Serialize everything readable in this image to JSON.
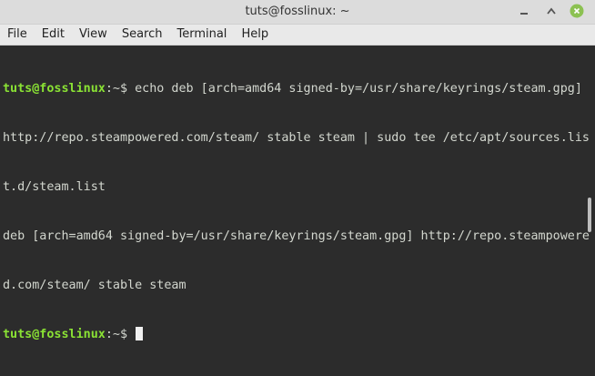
{
  "window": {
    "title": "tuts@fosslinux: ~"
  },
  "menu": [
    "File",
    "Edit",
    "View",
    "Search",
    "Terminal",
    "Help"
  ],
  "terminal": {
    "prompt_user_host": "tuts@fosslinux",
    "prompt_path": ":~$ ",
    "command_lines": [
      "echo deb [arch=amd64 signed-by=/usr/share/keyrings/steam.gpg]",
      "http://repo.steampowered.com/steam/ stable steam | sudo tee /etc/apt/sources.lis",
      "t.d/steam.list"
    ],
    "output_lines": [
      "deb [arch=amd64 signed-by=/usr/share/keyrings/steam.gpg] http://repo.steampowere",
      "d.com/steam/ stable steam"
    ]
  },
  "colors": {
    "prompt": "#8ae234",
    "text": "#d3d7cf",
    "background": "#2c2c2c"
  },
  "icons": [
    "minimize-icon",
    "maximize-icon",
    "close-icon"
  ]
}
